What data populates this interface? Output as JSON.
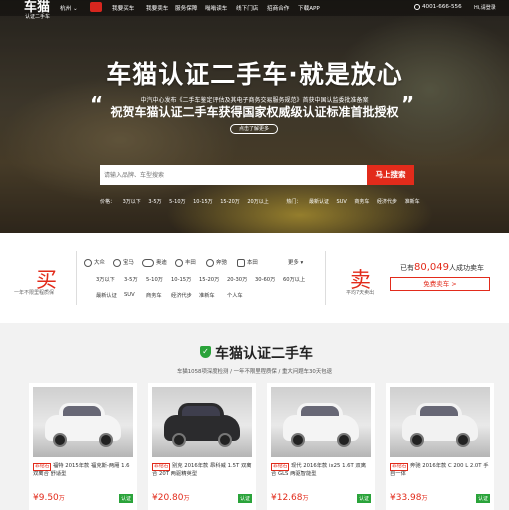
{
  "header": {
    "logo": "车猫",
    "logo_sub": "认证二手车",
    "city": "杭州 ⌄",
    "nav": [
      "我要买车",
      "我要卖车",
      "服务保障",
      "嗡嗡读车",
      "线下门店",
      "招商合作",
      "下载APP"
    ],
    "phone": "4001-666-556",
    "login": "Hi,请登录"
  },
  "hero": {
    "headline": "车猫认证二手车·就是放心",
    "sub1": "中汽中心发布《二手车鉴定评估及其电子商务交易服务规范》首获中国认监委批准备案",
    "sub2": "祝贺车猫认证二手车获得国家权威级认证标准首批授权",
    "learn_more": "点击了解更多",
    "search_placeholder": "请输入品牌、车型搜索",
    "search_button": "马上搜索",
    "price_filters": [
      "价格：",
      "3万以下",
      "3-5万",
      "5-10万",
      "10-15万",
      "15-20万",
      "20万以上"
    ],
    "hot_filters": [
      "热门：",
      "最新认证",
      "SUV",
      "商务车",
      "经济代步",
      "准新车"
    ]
  },
  "buy": {
    "big": "买",
    "sub": "一年不限里程质保",
    "brands": [
      "大众",
      "宝马",
      "奥迪",
      "丰田",
      "奔驰",
      "本田",
      "更多 ▾"
    ],
    "prices": [
      "3万以下",
      "3-5万",
      "5-10万",
      "10-15万",
      "15-20万",
      "20-30万",
      "30-60万",
      "60万以上"
    ],
    "tags": [
      "最新认证",
      "SUV",
      "商务车",
      "经济代步",
      "准新车",
      "个人车"
    ]
  },
  "sell": {
    "big": "卖",
    "sub": "平均7天卖出",
    "sold_prefix": "已有",
    "sold_count": "80,049",
    "sold_suffix": "人成功卖车",
    "button": "免费卖车 >"
  },
  "certified": {
    "title": "车猫认证二手车",
    "subtitle": "车猫1058项深度检测 / 一年不限里程质保 / 重大问题车30天包退",
    "cards": [
      {
        "tag": "非钻石",
        "title": "福特 2015年款 福克斯-两厢 1.6 双离合 舒适型",
        "price": "¥9.50",
        "unit": "万",
        "badge": "认证",
        "body_color": "#f4f4f4"
      },
      {
        "tag": "非钻石",
        "title": "别克 2016年款 昂科威 1.5T 双离合 20T 两驱精英型",
        "price": "¥20.80",
        "unit": "万",
        "badge": "认证",
        "body_color": "#2b2b2d"
      },
      {
        "tag": "非钻石",
        "title": "现代 2016年款 ix25 1.6T 双离合 GLS 两驱智能型",
        "price": "¥12.68",
        "unit": "万",
        "badge": "认证",
        "body_color": "#f4f4f4"
      },
      {
        "tag": "非钻石",
        "title": "奔驰 2016年款 C 200 L 2.0T 手自一体",
        "price": "¥33.98",
        "unit": "万",
        "badge": "认证",
        "body_color": "#f2f2f2"
      }
    ]
  },
  "colors": {
    "accent_red": "#e22b1b",
    "cert_green": "#2aa33a"
  }
}
